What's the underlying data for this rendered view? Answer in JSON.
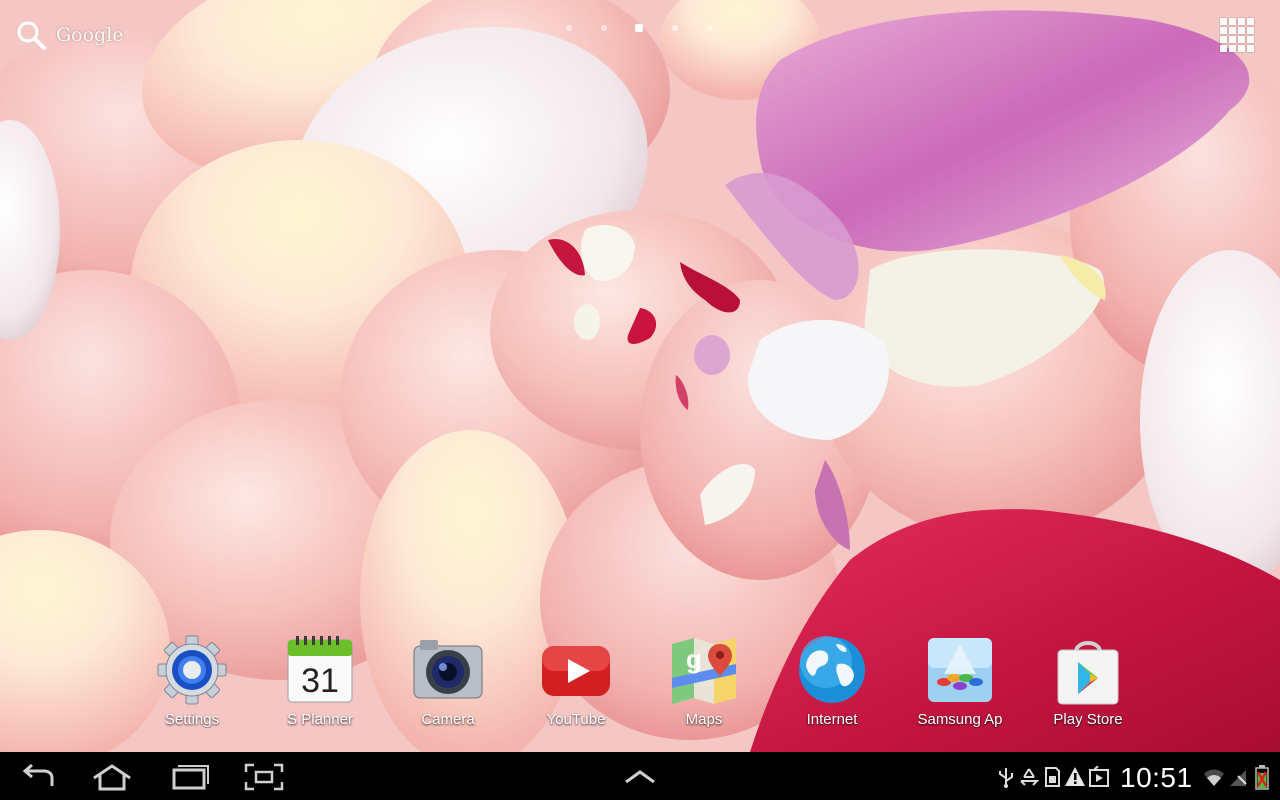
{
  "search": {
    "label": "Google",
    "icon": "search-icon"
  },
  "pages": {
    "count": 5,
    "current": 3
  },
  "apps_button": {
    "icon": "apps-grid-icon"
  },
  "dock": [
    {
      "label": "Settings",
      "icon": "settings-gear-icon"
    },
    {
      "label": "S Planner",
      "icon": "calendar-icon",
      "date": "31"
    },
    {
      "label": "Camera",
      "icon": "camera-icon"
    },
    {
      "label": "YouTube",
      "icon": "youtube-icon"
    },
    {
      "label": "Maps",
      "icon": "maps-icon"
    },
    {
      "label": "Internet",
      "icon": "globe-icon"
    },
    {
      "label": "Samsung Ap",
      "icon": "samsung-apps-icon"
    },
    {
      "label": "Play Store",
      "icon": "play-store-icon"
    }
  ],
  "navbar": {
    "buttons": [
      "back-icon",
      "home-icon",
      "recent-apps-icon",
      "screenshot-icon",
      "notification-panel-icon"
    ],
    "status_icons": [
      "usb-icon",
      "recycle-icon",
      "sd-card-icon",
      "warning-icon",
      "play-icon",
      "wifi-icon",
      "signal-icon",
      "battery-icon"
    ],
    "time": "10:51"
  }
}
